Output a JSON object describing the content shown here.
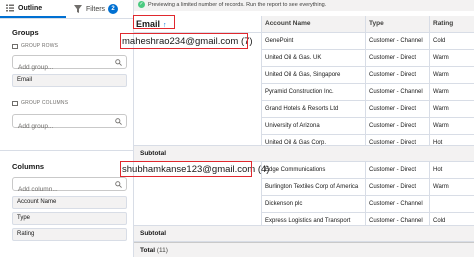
{
  "left_panel": {
    "tabs": [
      {
        "label": "Outline",
        "icon": "outline-icon"
      },
      {
        "label": "Filters",
        "icon": "filter-icon",
        "count": "2"
      }
    ],
    "groups": {
      "title": "Groups",
      "group_rows_label": "GROUP ROWS",
      "rows_search_placeholder": "Add group...",
      "row_chips": [
        "Email"
      ],
      "group_columns_label": "GROUP COLUMNS",
      "columns_search_placeholder": "Add group..."
    },
    "columns": {
      "title": "Columns",
      "search_placeholder": "Add column...",
      "items": [
        "Account Name",
        "Type",
        "Rating"
      ]
    }
  },
  "report": {
    "banner": "Previewing a limited number of records. Run the report to see everything.",
    "headers": {
      "email": "Email",
      "sort_icon": "sort-ascending-icon",
      "account_name": "Account Name",
      "type": "Type",
      "rating": "Rating"
    },
    "groups": [
      {
        "value": "maheshrao234@gmail.com (7)",
        "rows": [
          {
            "account": "GenePoint",
            "type": "Customer - Channel",
            "rating": "Cold"
          },
          {
            "account": "United Oil & Gas. UK",
            "type": "Customer - Direct",
            "rating": "Warm"
          },
          {
            "account": "United Oil & Gas, Singapore",
            "type": "Customer - Direct",
            "rating": "Warm"
          },
          {
            "account": "Pyramid Construction Inc.",
            "type": "Customer - Channel",
            "rating": "Warm"
          },
          {
            "account": "Grand Hotels & Resorts Ltd",
            "type": "Customer - Direct",
            "rating": "Warm"
          },
          {
            "account": "University of Arizona",
            "type": "Customer - Direct",
            "rating": "Warm"
          },
          {
            "account": "United Oil & Gas Corp.",
            "type": "Customer - Direct",
            "rating": "Hot"
          }
        ],
        "subtotal_label": "Subtotal"
      },
      {
        "value": "shubhamkanse123@gmail.com (4)",
        "rows": [
          {
            "account": "Edge Communications",
            "type": "Customer - Direct",
            "rating": "Hot"
          },
          {
            "account": "Burlington Textiles Corp of America",
            "type": "Customer - Direct",
            "rating": "Warm"
          },
          {
            "account": "Dickenson plc",
            "type": "Customer - Channel",
            "rating": ""
          },
          {
            "account": "Express Logistics and Transport",
            "type": "Customer - Channel",
            "rating": "Cold"
          }
        ],
        "subtotal_label": "Subtotal"
      }
    ],
    "total_label": "Total",
    "total_count": "(11)"
  },
  "colors": {
    "accent": "#0070d2",
    "highlight_box": "#e0282e",
    "success": "#4bca81"
  }
}
